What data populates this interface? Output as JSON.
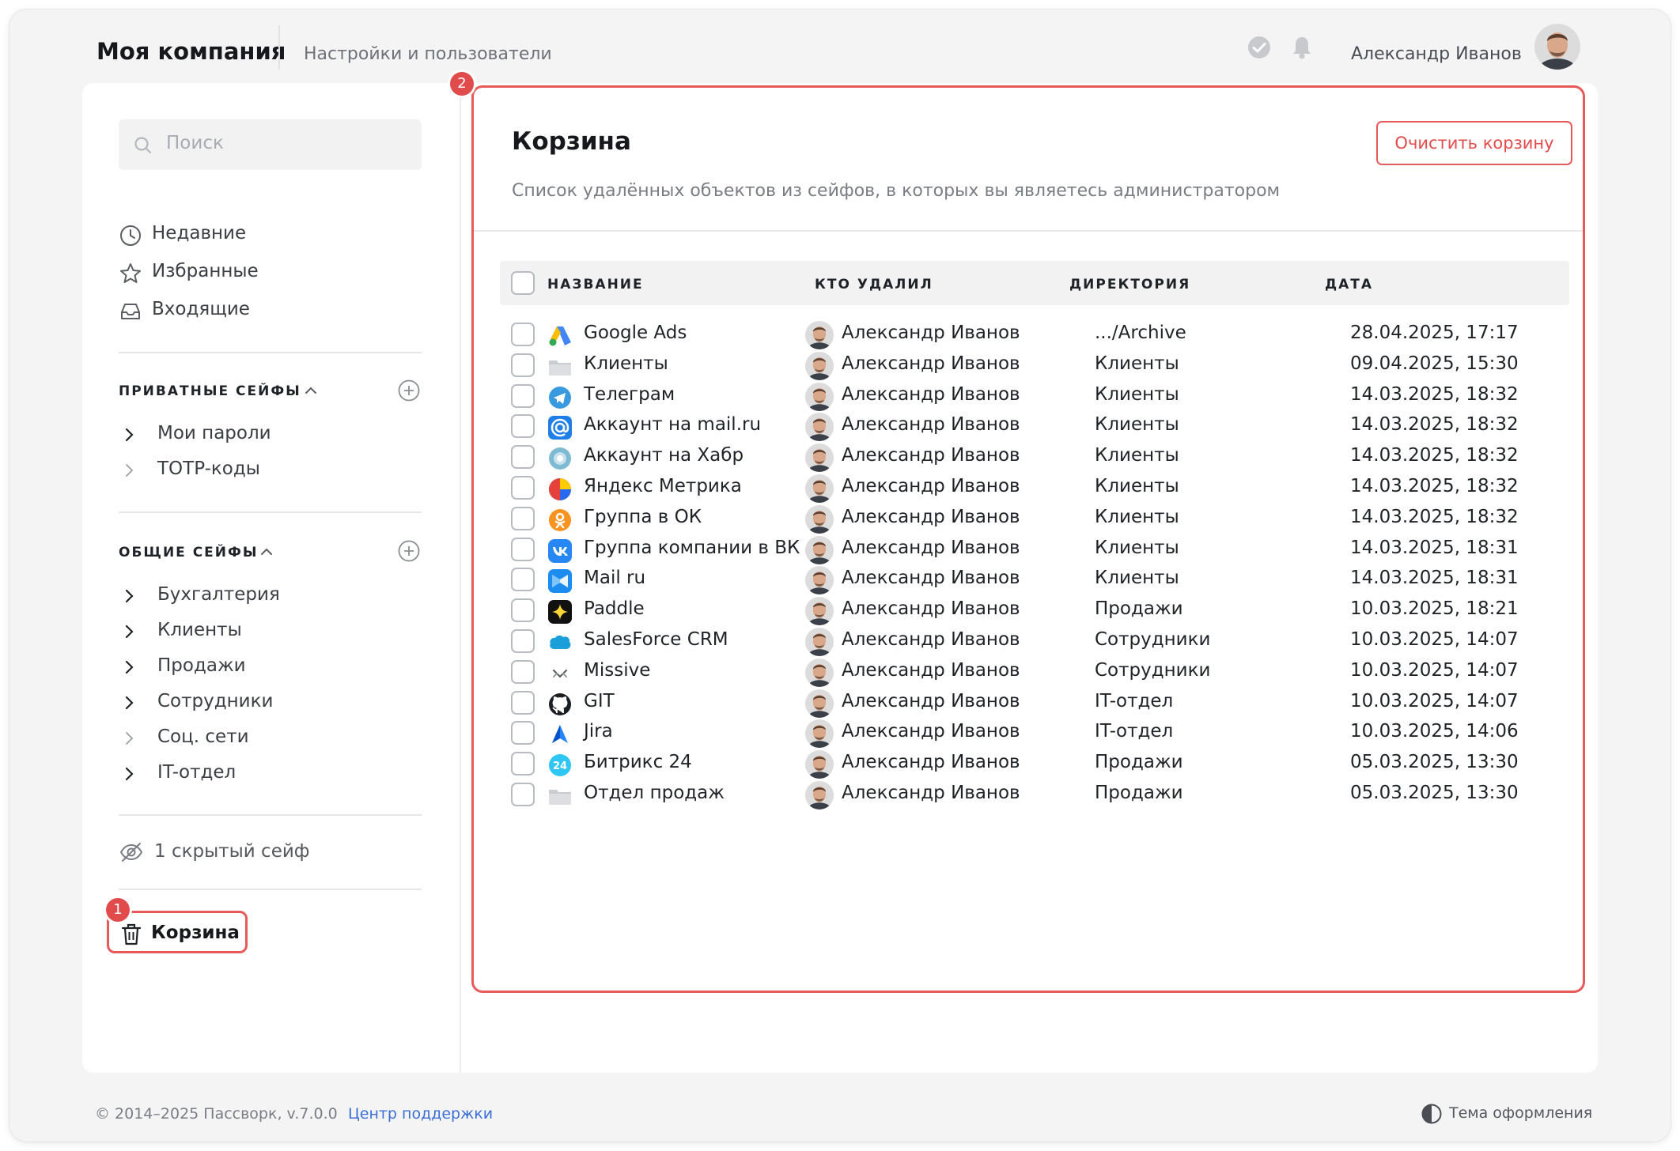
{
  "header": {
    "brand": "Моя компания",
    "subtitle": "Настройки и пользователи",
    "user_name": "Александр Иванов"
  },
  "sidebar": {
    "search_placeholder": "Поиск",
    "quick": [
      {
        "label": "Недавние",
        "icon": "clock-icon"
      },
      {
        "label": "Избранные",
        "icon": "star-icon"
      },
      {
        "label": "Входящие",
        "icon": "inbox-icon"
      }
    ],
    "private_title": "ПРИВАТНЫЕ СЕЙФЫ",
    "private_items": [
      "Мои пароли",
      "TOTP-коды"
    ],
    "shared_title": "ОБЩИЕ СЕЙФЫ",
    "shared_items": [
      "Бухгалтерия",
      "Клиенты",
      "Продажи",
      "Сотрудники",
      "Соц. сети",
      "IT-отдел"
    ],
    "hidden_safes": "1 скрытый сейф",
    "trash_label": "Корзина",
    "badge_1": "1"
  },
  "main": {
    "badge_2": "2",
    "title": "Корзина",
    "description": "Список удалённых объектов из сейфов, в которых вы являетесь администратором",
    "clear_button": "Очистить корзину",
    "columns": {
      "name": "НАЗВАНИЕ",
      "who": "КТО УДАЛИЛ",
      "dir": "ДИРЕКТОРИЯ",
      "date": "ДАТА"
    },
    "rows": [
      {
        "name": "Google Ads",
        "icon": "google-ads-icon",
        "who": "Александр Иванов",
        "dir": ".../Archive",
        "date": "28.04.2025, 17:17"
      },
      {
        "name": "Клиенты",
        "icon": "folder-icon",
        "who": "Александр Иванов",
        "dir": "Клиенты",
        "date": "09.04.2025, 15:30"
      },
      {
        "name": "Телеграм",
        "icon": "telegram-icon",
        "who": "Александр Иванов",
        "dir": "Клиенты",
        "date": "14.03.2025, 18:32"
      },
      {
        "name": "Аккаунт на mail.ru",
        "icon": "mailru-at-icon",
        "who": "Александр Иванов",
        "dir": "Клиенты",
        "date": "14.03.2025, 18:32"
      },
      {
        "name": "Аккаунт на Хабр",
        "icon": "habr-icon",
        "who": "Александр Иванов",
        "dir": "Клиенты",
        "date": "14.03.2025, 18:32"
      },
      {
        "name": "Яндекс Метрика",
        "icon": "yandex-metrika-icon",
        "who": "Александр Иванов",
        "dir": "Клиенты",
        "date": "14.03.2025, 18:32"
      },
      {
        "name": "Группа в ОК",
        "icon": "odnoklassniki-icon",
        "who": "Александр Иванов",
        "dir": "Клиенты",
        "date": "14.03.2025, 18:32"
      },
      {
        "name": "Группа компании в ВК",
        "icon": "vk-icon",
        "who": "Александр Иванов",
        "dir": "Клиенты",
        "date": "14.03.2025, 18:31"
      },
      {
        "name": "Mail ru",
        "icon": "mailru-icon",
        "who": "Александр Иванов",
        "dir": "Клиенты",
        "date": "14.03.2025, 18:31"
      },
      {
        "name": "Paddle",
        "icon": "paddle-icon",
        "who": "Александр Иванов",
        "dir": "Продажи",
        "date": "10.03.2025, 18:21"
      },
      {
        "name": "SalesForce CRM",
        "icon": "salesforce-icon",
        "who": "Александр Иванов",
        "dir": "Сотрудники",
        "date": "10.03.2025, 14:07"
      },
      {
        "name": "Missive",
        "icon": "missive-icon",
        "who": "Александр Иванов",
        "dir": "Сотрудники",
        "date": "10.03.2025, 14:07"
      },
      {
        "name": "GIT",
        "icon": "github-icon",
        "who": "Александр Иванов",
        "dir": "IT-отдел",
        "date": "10.03.2025, 14:07"
      },
      {
        "name": "Jira",
        "icon": "jira-icon",
        "who": "Александр Иванов",
        "dir": "IT-отдел",
        "date": "10.03.2025, 14:06"
      },
      {
        "name": "Битрикс 24",
        "icon": "bitrix24-icon",
        "who": "Александр Иванов",
        "dir": "Продажи",
        "date": "05.03.2025, 13:30"
      },
      {
        "name": "Отдел продаж",
        "icon": "folder-icon",
        "who": "Александр Иванов",
        "dir": "Продажи",
        "date": "05.03.2025, 13:30"
      }
    ]
  },
  "footer": {
    "copyright": "© 2014–2025 Пассворк, v.7.0.0",
    "support": "Центр поддержки",
    "theme": "Тема оформления"
  },
  "colors": {
    "accent": "#e24b4b",
    "link": "#3b6fd6",
    "background": "#f4f4f5"
  }
}
